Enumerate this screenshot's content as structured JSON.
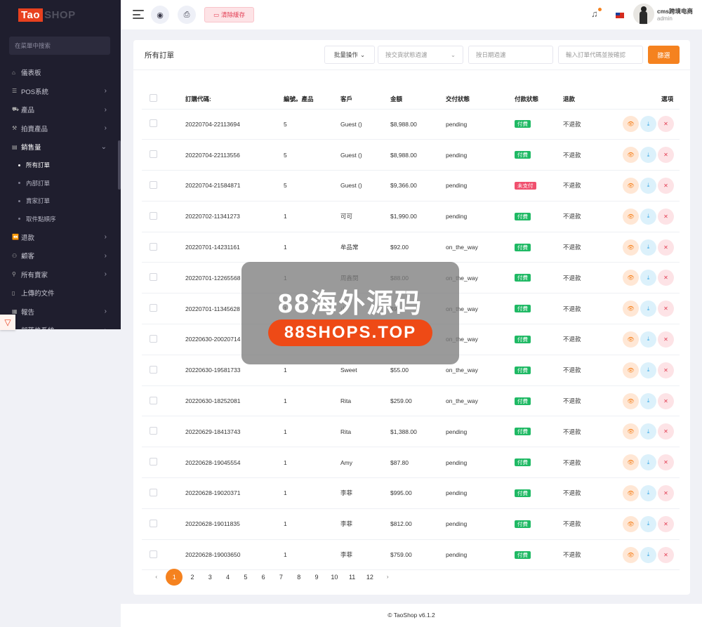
{
  "brand": {
    "logo_left": "Tao",
    "logo_right": "SHOP"
  },
  "sidebar": {
    "search_placeholder": "在菜單中搜索",
    "items": [
      {
        "label": "儀表板",
        "icon": "home-icon",
        "chev": ""
      },
      {
        "label": "POS系統",
        "icon": "list-icon",
        "chev": "›"
      },
      {
        "label": "產品",
        "icon": "cart-icon",
        "chev": "›"
      },
      {
        "label": "拍賣產品",
        "icon": "gavel-icon",
        "chev": "›"
      },
      {
        "label": "銷售量",
        "icon": "wallet-icon",
        "chev": "⌄"
      },
      {
        "label": "退款",
        "icon": "backward-icon",
        "chev": "›"
      },
      {
        "label": "顧客",
        "icon": "users-icon",
        "chev": "›"
      },
      {
        "label": "所有賣家",
        "icon": "user-icon",
        "chev": "›"
      },
      {
        "label": "上傳的文件",
        "icon": "file-icon",
        "chev": ""
      },
      {
        "label": "報告",
        "icon": "report-icon",
        "chev": "›"
      },
      {
        "label": "部落格系統",
        "icon": "blog-icon",
        "chev": "›"
      }
    ],
    "sales_sub": [
      "所有訂單",
      "內部訂單",
      "賣家訂單",
      "取件點順序"
    ]
  },
  "topbar": {
    "clear_cache": "清除緩存",
    "user_name": "cms跨境电商",
    "user_role": "admin"
  },
  "orders": {
    "title": "所有訂單",
    "bulk": "批量操作",
    "status_filter": "按交貨狀態過濾",
    "date_filter": "按日期過濾",
    "code_filter": "輸入訂單代碼並按確認",
    "filter_btn": "篩選",
    "columns": [
      "訂購代碼:",
      "編號。產品",
      "客戶",
      "金額",
      "交付狀態",
      "付款狀態",
      "退款",
      "選項"
    ],
    "rows": [
      {
        "code": "20220704-22113694",
        "qty": "5",
        "customer": "Guest ()",
        "amount": "$8,988.00",
        "delivery": "pending",
        "payment": "付費",
        "paid": true,
        "refund": "不退款"
      },
      {
        "code": "20220704-22113556",
        "qty": "5",
        "customer": "Guest ()",
        "amount": "$8,988.00",
        "delivery": "pending",
        "payment": "付費",
        "paid": true,
        "refund": "不退款"
      },
      {
        "code": "20220704-21584871",
        "qty": "5",
        "customer": "Guest ()",
        "amount": "$9,366.00",
        "delivery": "pending",
        "payment": "未支付",
        "paid": false,
        "refund": "不退款"
      },
      {
        "code": "20220702-11341273",
        "qty": "1",
        "customer": "可可",
        "amount": "$1,990.00",
        "delivery": "pending",
        "payment": "付費",
        "paid": true,
        "refund": "不退款"
      },
      {
        "code": "20220701-14231161",
        "qty": "1",
        "customer": "牟品常",
        "amount": "$92.00",
        "delivery": "on_the_way",
        "payment": "付費",
        "paid": true,
        "refund": "不退款"
      },
      {
        "code": "20220701-12265568",
        "qty": "1",
        "customer": "周鑫閔",
        "amount": "$88.00",
        "delivery": "on_the_way",
        "payment": "付費",
        "paid": true,
        "refund": "不退款"
      },
      {
        "code": "20220701-11345628",
        "qty": "1",
        "customer": "小",
        "amount": "$97.0",
        "delivery": "on_the_way",
        "payment": "付費",
        "paid": true,
        "refund": "不退款"
      },
      {
        "code": "20220630-20020714",
        "qty": "1",
        "customer": "",
        "amount": "",
        "delivery": "on_the_way",
        "payment": "付費",
        "paid": true,
        "refund": "不退款"
      },
      {
        "code": "20220630-19581733",
        "qty": "1",
        "customer": "Sweet",
        "amount": "$55.00",
        "delivery": "on_the_way",
        "payment": "付費",
        "paid": true,
        "refund": "不退款"
      },
      {
        "code": "20220630-18252081",
        "qty": "1",
        "customer": "Rita",
        "amount": "$259.00",
        "delivery": "on_the_way",
        "payment": "付費",
        "paid": true,
        "refund": "不退款"
      },
      {
        "code": "20220629-18413743",
        "qty": "1",
        "customer": "Rita",
        "amount": "$1,388.00",
        "delivery": "pending",
        "payment": "付費",
        "paid": true,
        "refund": "不退款"
      },
      {
        "code": "20220628-19045554",
        "qty": "1",
        "customer": "Amy",
        "amount": "$87.80",
        "delivery": "pending",
        "payment": "付費",
        "paid": true,
        "refund": "不退款"
      },
      {
        "code": "20220628-19020371",
        "qty": "1",
        "customer": "李菲",
        "amount": "$995.00",
        "delivery": "pending",
        "payment": "付費",
        "paid": true,
        "refund": "不退款"
      },
      {
        "code": "20220628-19011835",
        "qty": "1",
        "customer": "李菲",
        "amount": "$812.00",
        "delivery": "pending",
        "payment": "付費",
        "paid": true,
        "refund": "不退款"
      },
      {
        "code": "20220628-19003650",
        "qty": "1",
        "customer": "李菲",
        "amount": "$759.00",
        "delivery": "pending",
        "payment": "付費",
        "paid": true,
        "refund": "不退款"
      }
    ]
  },
  "pagination": {
    "prev": "‹",
    "pages": [
      "1",
      "2",
      "3",
      "4",
      "5",
      "6",
      "7",
      "8",
      "9",
      "10",
      "11",
      "12"
    ],
    "next": "›",
    "current": "1"
  },
  "footer": {
    "text": "© TaoShop v6.1.2"
  },
  "watermark": {
    "title": "88海外源码",
    "url": "88SHOPS.TOP"
  },
  "colors": {
    "accent": "#f5821f",
    "sidebar_bg": "#1f1e2e",
    "paid": "#1fb964",
    "unpaid": "#f0506e",
    "clear_cache": "#e23d53"
  }
}
